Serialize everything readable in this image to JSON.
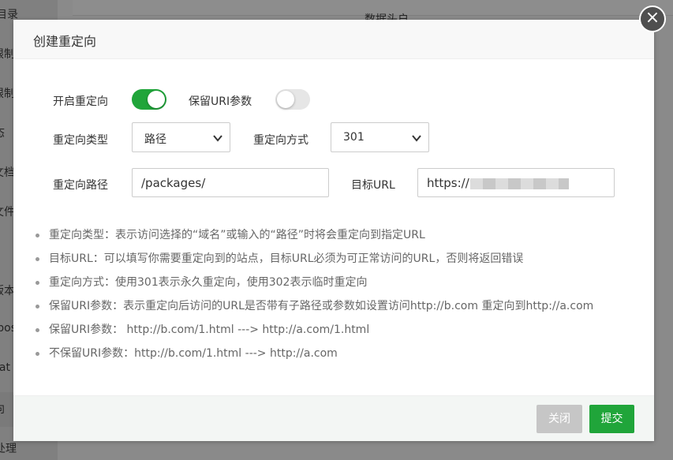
{
  "background": {
    "sidebar_fragments": [
      "目录",
      "限制",
      "限制",
      "态",
      "文档",
      "文件",
      "版本",
      "pos",
      "at",
      "向",
      "处理"
    ],
    "header_fragment": "数据头户"
  },
  "modal": {
    "title": "创建重定向",
    "close_icon": "×",
    "enable_redirect_label": "开启重定向",
    "enable_redirect_on": true,
    "keep_uri_label": "保留URI参数",
    "keep_uri_on": false,
    "redirect_type_label": "重定向类型",
    "redirect_type_value": "路径",
    "redirect_method_label": "重定向方式",
    "redirect_method_value": "301",
    "redirect_path_label": "重定向路径",
    "redirect_path_value": "/packages/",
    "target_url_label": "目标URL",
    "target_url_value": "https://",
    "tips": [
      "重定向类型：表示访问选择的“域名”或输入的“路径”时将会重定向到指定URL",
      "目标URL：可以填写你需要重定向到的站点，目标URL必须为可正常访问的URL，否则将返回错误",
      "重定向方式：使用301表示永久重定向，使用302表示临时重定向",
      "保留URI参数：表示重定向后访问的URL是否带有子路径或参数如设置访问http://b.com 重定向到http://a.com",
      "保留URI参数：  http://b.com/1.html ---> http://a.com/1.html",
      "不保留URI参数：http://b.com/1.html ---> http://a.com"
    ],
    "cancel_label": "关闭",
    "submit_label": "提交"
  },
  "colors": {
    "accent": "#20a53a",
    "cancel": "#c6c6c6",
    "overlay": "#808080"
  }
}
